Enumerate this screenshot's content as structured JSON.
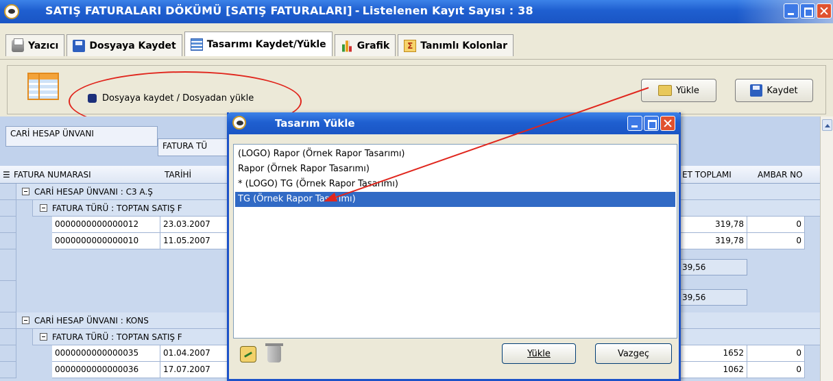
{
  "window": {
    "title": "SATIŞ FATURALARI DÖKÜMÜ [SATIŞ FATURALARI]",
    "separator": "-",
    "record_count": "Listelenen Kayıt Sayısı : 38"
  },
  "tabs": [
    {
      "label": "Yazıcı",
      "icon": "printer-icon"
    },
    {
      "label": "Dosyaya Kaydet",
      "icon": "floppy-icon"
    },
    {
      "label": "Tasarımı Kaydet/Yükle",
      "icon": "table-icon",
      "active": true
    },
    {
      "label": "Grafik",
      "icon": "chart-icon"
    },
    {
      "label": "Tanımlı Kolonlar",
      "icon": "sigma-icon"
    }
  ],
  "panel": {
    "option_label": "Dosyaya kaydet / Dosyadan yükle",
    "load_button": "Yükle",
    "save_button": "Kaydet"
  },
  "grid": {
    "group_chips": [
      "CARİ HESAP ÜNVANI",
      "FATURA TÜ"
    ],
    "columns": [
      "FATURA NUMARASI",
      "TARİHİ",
      "ET TOPLAMI",
      "AMBAR NO"
    ],
    "groups": [
      {
        "label": "CARİ HESAP ÜNVANI : C3 A.Ş",
        "subgroup": "FATURA TÜRÜ : TOPTAN SATIŞ F",
        "rows": [
          {
            "number": "0000000000000012",
            "date": "23.03.2007",
            "total": "319,78",
            "warehouse": "0"
          },
          {
            "number": "0000000000000010",
            "date": "11.05.2007",
            "total": "319,78",
            "warehouse": "0"
          }
        ],
        "subtotal": "39,56",
        "total": "39,56"
      },
      {
        "label": "CARİ HESAP ÜNVANI : KONS",
        "subgroup": "FATURA TÜRÜ : TOPTAN SATIŞ F",
        "rows": [
          {
            "number": "0000000000000035",
            "date": "01.04.2007",
            "total": "1652",
            "warehouse": "0"
          },
          {
            "number": "0000000000000036",
            "date": "17.07.2007",
            "total": "1062",
            "warehouse": "0"
          }
        ]
      }
    ]
  },
  "dialog": {
    "title": "Tasarım Yükle",
    "items": [
      "(LOGO) Rapor  (Örnek Rapor Tasarımı)",
      "Rapor  (Örnek Rapor Tasarımı)",
      "* (LOGO) TG  (Örnek Rapor Tasarımı)",
      "TG  (Örnek Rapor Tasarımı)"
    ],
    "selected_index": 3,
    "load_button": "Yükle",
    "cancel_button": "Vazgeç"
  },
  "colors": {
    "title_bar": "#1f5fd0",
    "selection": "#316ac5",
    "annotation": "#e0261d"
  }
}
